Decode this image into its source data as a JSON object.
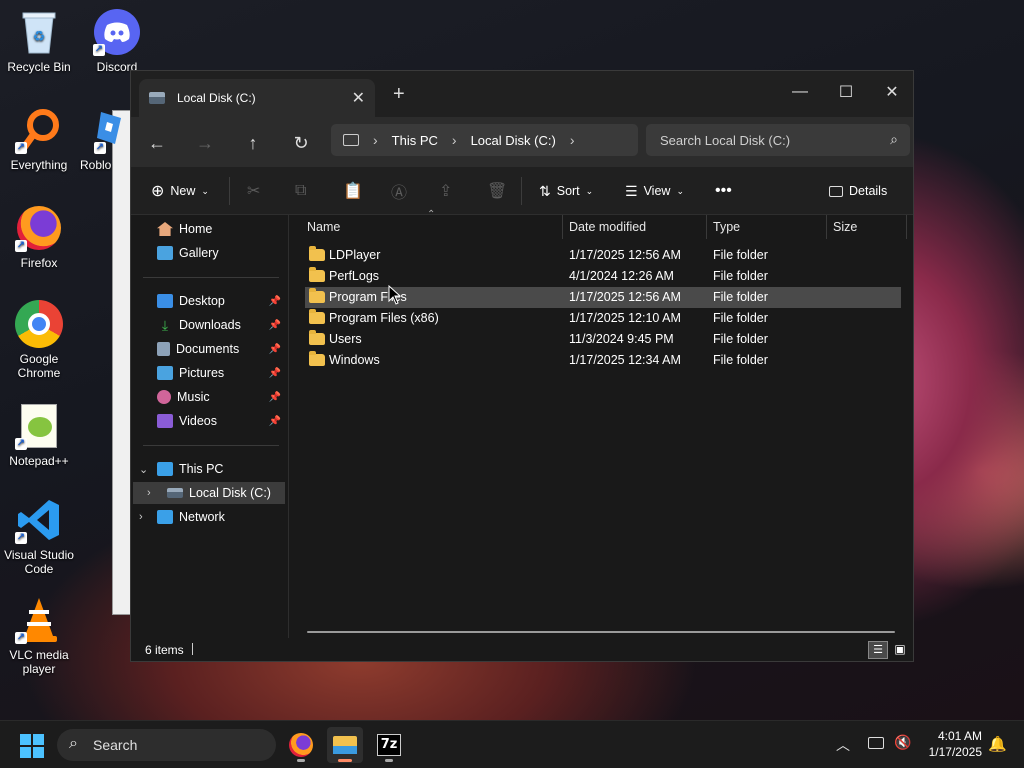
{
  "desktop": {
    "icons": [
      {
        "label": "Recycle Bin"
      },
      {
        "label": "Discord"
      },
      {
        "label": "Everything"
      },
      {
        "label": "Roblo"
      },
      {
        "label": "Firefox"
      },
      {
        "label": "Google Chrome"
      },
      {
        "label": "Notepad++"
      },
      {
        "label": "Visual Studio Code"
      },
      {
        "label": "VLC media player"
      }
    ]
  },
  "explorer": {
    "tab_title": "Local Disk (C:)",
    "address": {
      "crumbs": [
        "This PC",
        "Local Disk (C:)"
      ]
    },
    "search_placeholder": "Search Local Disk (C:)",
    "toolbar": {
      "new": "New",
      "sort": "Sort",
      "view": "View",
      "details": "Details"
    },
    "sidebar": {
      "quick": [
        {
          "label": "Home"
        },
        {
          "label": "Gallery"
        }
      ],
      "pinned": [
        {
          "label": "Desktop",
          "color": "#3a8ee6"
        },
        {
          "label": "Downloads",
          "color": "#3fb950"
        },
        {
          "label": "Documents",
          "color": "#8da2b8"
        },
        {
          "label": "Pictures",
          "color": "#4aa3e0"
        },
        {
          "label": "Music",
          "color": "#d0659a"
        },
        {
          "label": "Videos",
          "color": "#8a5cd6"
        }
      ],
      "this_pc": "This PC",
      "local_disk": "Local Disk (C:)",
      "network": "Network"
    },
    "columns": [
      "Name",
      "Date modified",
      "Type",
      "Size"
    ],
    "files": [
      {
        "name": "LDPlayer",
        "date": "1/17/2025 12:56 AM",
        "type": "File folder"
      },
      {
        "name": "PerfLogs",
        "date": "4/1/2024 12:26 AM",
        "type": "File folder"
      },
      {
        "name": "Program Files",
        "date": "1/17/2025 12:56 AM",
        "type": "File folder"
      },
      {
        "name": "Program Files (x86)",
        "date": "1/17/2025 12:10 AM",
        "type": "File folder"
      },
      {
        "name": "Users",
        "date": "11/3/2024 9:45 PM",
        "type": "File folder"
      },
      {
        "name": "Windows",
        "date": "1/17/2025 12:34 AM",
        "type": "File folder"
      }
    ],
    "status": "6 items"
  },
  "taskbar": {
    "search_label": "Search",
    "apps": [
      "firefox-icon",
      "file-explorer-icon",
      "7zip-icon"
    ],
    "time": "4:01 AM",
    "date": "1/17/2025"
  }
}
